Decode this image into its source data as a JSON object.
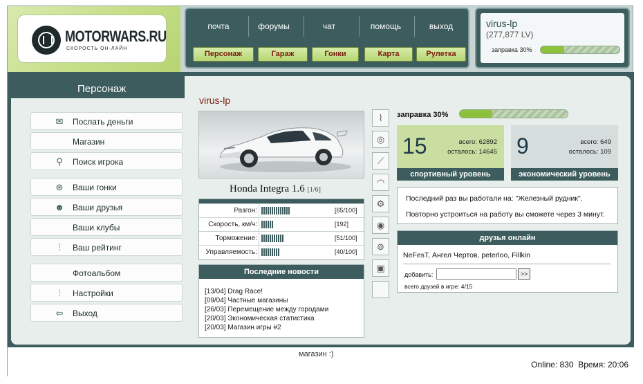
{
  "brand": {
    "logo_text": "MOTORWARS.RU",
    "logo_sub": "СКОРОСТЬ ОН-ЛАЙН"
  },
  "nav": {
    "top": [
      "почта",
      "форумы",
      "чат",
      "помощь",
      "выход"
    ],
    "buttons": [
      "Персонаж",
      "Гараж",
      "Гонки",
      "Карта",
      "Рулетка"
    ]
  },
  "user": {
    "name": "virus-lp",
    "money": "(277,877 LV)",
    "fuel_label": "заправка 30%",
    "fuel_percent": 30
  },
  "sidebar": {
    "title": "Персонаж",
    "items": [
      {
        "label": "Послать деньги",
        "icon": "money-icon"
      },
      {
        "label": "Магазин",
        "icon": ""
      },
      {
        "label": "Поиск игрока",
        "icon": "search-icon"
      },
      {
        "label": "Ваши гонки",
        "icon": "steering-wheel-icon"
      },
      {
        "label": "Ваши друзья",
        "icon": "friends-icon"
      },
      {
        "label": "Ваши клубы",
        "icon": ""
      },
      {
        "label": "Ваш рейтинг",
        "icon": "rating-icon"
      },
      {
        "label": "Фотоальбом",
        "icon": ""
      },
      {
        "label": "Настройки",
        "icon": "settings-icon"
      },
      {
        "label": "Выход",
        "icon": "exit-icon"
      }
    ]
  },
  "car": {
    "owner": "virus-lp",
    "model": "Honda Integra 1.6",
    "slot": "[1/6]",
    "stats": [
      {
        "label": "Разгон:",
        "value": "[65/100]",
        "segments": 14
      },
      {
        "label": "Скорость, км/ч:",
        "value": "[192]",
        "segments": 6
      },
      {
        "label": "Торможение:",
        "value": "[51/100]",
        "segments": 11
      },
      {
        "label": "Управляемость:",
        "value": "[40/100]",
        "segments": 9
      }
    ]
  },
  "news": {
    "title": "Последние новости",
    "items": [
      "[13/04] Drag Race!",
      "[09/04] Частные магазины",
      "[26/03] Перемещение между городами",
      "[20/03] Экономическая статистика",
      "[20/03] Магазин игры #2"
    ]
  },
  "parts": [
    "spring-icon",
    "tire-icon",
    "exhaust-icon",
    "rim-icon",
    "gear-icon",
    "brake-icon",
    "turbo-icon",
    "piston-icon",
    ""
  ],
  "status": {
    "fuel_label": "заправка 30%",
    "fuel_percent": 30
  },
  "levels": {
    "sport": {
      "value": "15",
      "total_label": "всего:",
      "total": "62892",
      "left_label": "осталось:",
      "left": "14645",
      "caption": "спортивный уровень",
      "bg": "#c9dea0"
    },
    "econ": {
      "value": "9",
      "total_label": "всего:",
      "total": "649",
      "left_label": "осталось:",
      "left": "109",
      "caption": "экономический уровень",
      "bg": "#d6dedd"
    }
  },
  "work": {
    "line1": "Последний раз вы работали на: \"Железный рудник\".",
    "line2": "Повторно устроиться на работу вы сможете через 3 минут."
  },
  "friends": {
    "title": "друзья онлайн",
    "list": "NeFesT, Ангел Чертов, peterloo, Fillkin",
    "add_label": "добавить:",
    "add_button": ">>",
    "total": "всего друзей в игре: 4/15"
  },
  "footer": {
    "message": "магазин :)",
    "online": "Online: 830  Время: 20:06"
  }
}
